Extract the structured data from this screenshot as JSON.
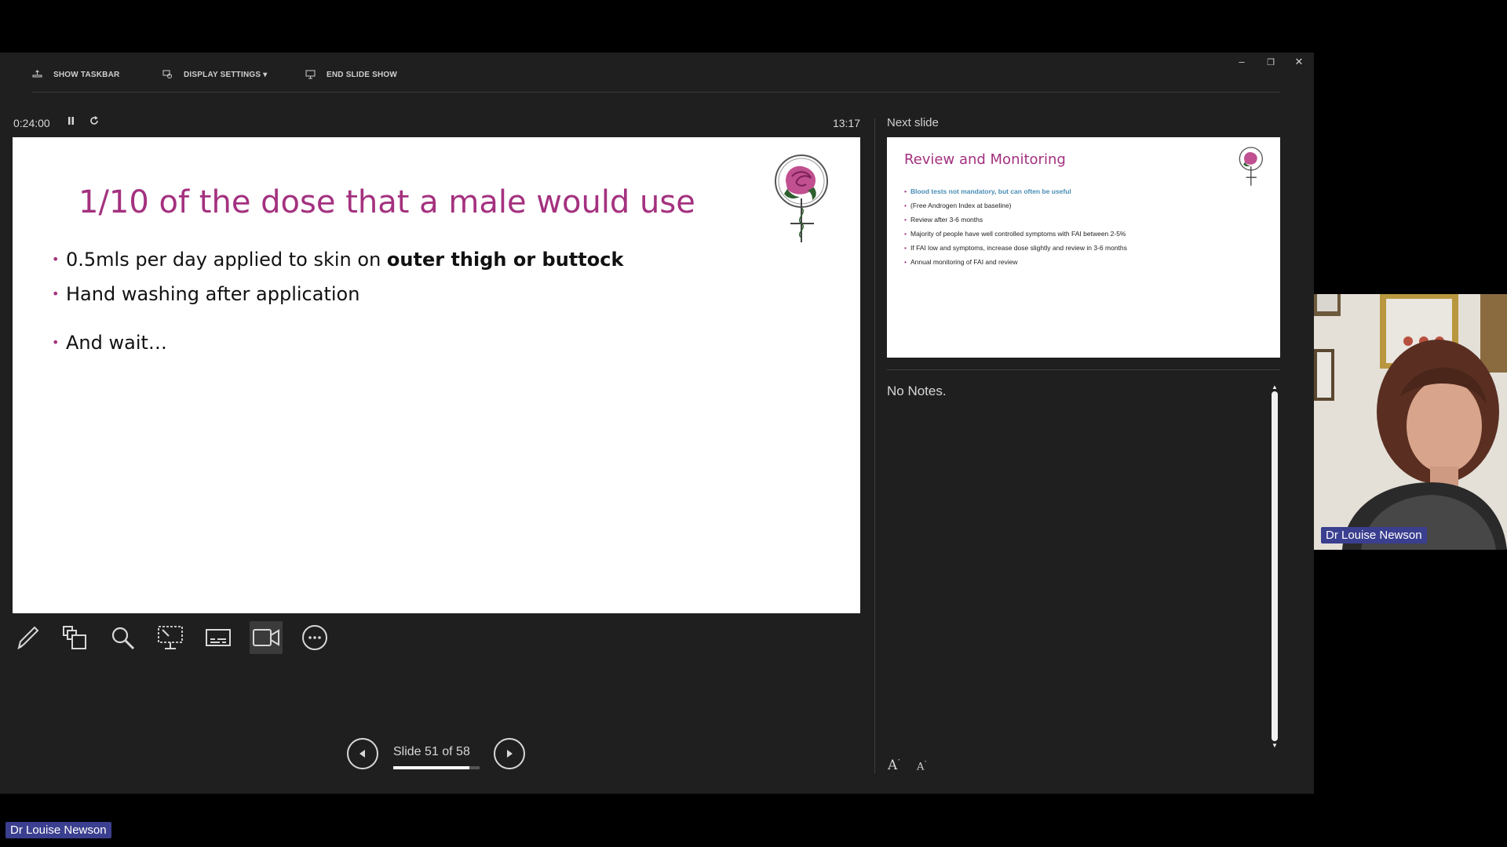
{
  "toolbar": {
    "show_taskbar": "SHOW TASKBAR",
    "display_settings": "DISPLAY SETTINGS ▾",
    "end_slide_show": "END SLIDE SHOW"
  },
  "window_controls": {
    "minimize": "–",
    "restore": "❐",
    "close": "✕"
  },
  "timer": {
    "elapsed": "0:24:00",
    "pause_icon": "pause-icon",
    "reset_icon": "reset-icon"
  },
  "clock": "13:17",
  "current_slide": {
    "title": "1/10 of the dose that a male would use",
    "bullets": [
      {
        "text": "0.5mls per day applied to skin on ",
        "bold": "outer thigh or buttock"
      },
      {
        "text": "Hand washing after application",
        "bold": ""
      },
      {
        "text": "And wait…",
        "bold": ""
      }
    ],
    "bullet_glyph": "•",
    "accent_color": "#a4317f"
  },
  "tools": [
    "pen-icon",
    "see-all-slides-icon",
    "zoom-icon",
    "pointer-screen-icon",
    "subtitles-icon",
    "camera-icon",
    "more-options-icon"
  ],
  "navigation": {
    "slide_counter": "Slide 51 of 58",
    "current": 51,
    "total": 58
  },
  "next_slide": {
    "label": "Next slide",
    "title": "Review and Monitoring",
    "bullets": [
      "Blood tests not mandatory, but can often be useful",
      "(Free Androgen Index at baseline)",
      "Review after 3-6 months",
      "Majority of people have well controlled symptoms with FAI between 2-5%",
      "If FAI low and symptoms, increase dose slightly and review in 3-6 months",
      "Annual monitoring of FAI and review"
    ]
  },
  "notes": {
    "text": "No Notes.",
    "increase_font": "A",
    "decrease_font": "A"
  },
  "participant": {
    "name": "Dr Louise Newson"
  },
  "bottom_name_tag": "Dr Louise Newson"
}
